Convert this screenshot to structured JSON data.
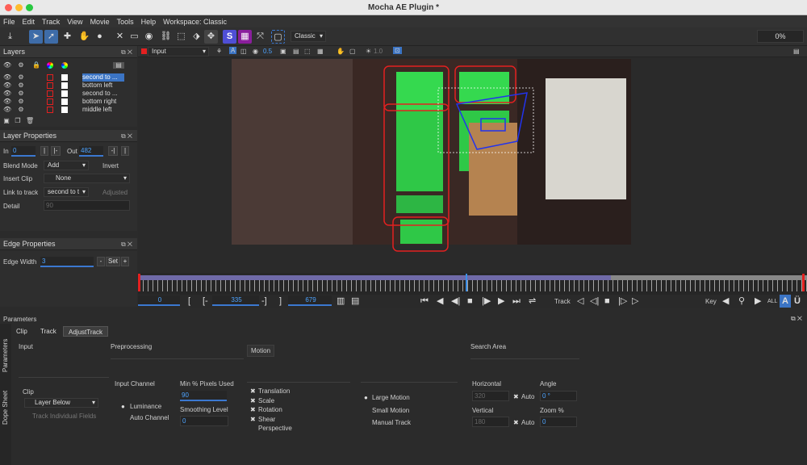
{
  "window": {
    "title": "Mocha AE Plugin *"
  },
  "menu": [
    "File",
    "Edit",
    "Track",
    "View",
    "Movie",
    "Tools",
    "Help",
    "Workspace: Classic"
  ],
  "toolbar": {
    "workspace_select": "Classic",
    "progress": "0%"
  },
  "viewer_bar": {
    "view_select": "Input",
    "value_a": "0.5",
    "value_b": "1.0"
  },
  "layers_panel": {
    "title": "Layers",
    "layers": [
      {
        "name": "second to ..."
      },
      {
        "name": "bottom left"
      },
      {
        "name": "second to ..."
      },
      {
        "name": "bottom right"
      },
      {
        "name": "middle left"
      }
    ]
  },
  "layer_properties": {
    "title": "Layer Properties",
    "in_label": "In",
    "in_value": "0",
    "out_label": "Out",
    "out_value": "482",
    "blend_mode_label": "Blend Mode",
    "blend_mode_value": "Add",
    "invert_label": "Invert",
    "insert_clip_label": "Insert Clip",
    "insert_clip_value": "None",
    "link_to_track_label": "Link to track",
    "link_to_track_value": "second to t",
    "adjusted_label": "Adjusted",
    "detail_label": "Detail",
    "detail_value": "90"
  },
  "edge_properties": {
    "title": "Edge Properties",
    "edge_width_label": "Edge Width",
    "edge_width_value": "3",
    "set_label": "Set"
  },
  "transport": {
    "current_frame": "0",
    "in_frame": "335",
    "out_frame": "679",
    "track_label": "Track",
    "key_label": "Key",
    "all_label": "ALL"
  },
  "params": {
    "title": "Parameters",
    "tabs": [
      "Clip",
      "Track",
      "AdjustTrack"
    ],
    "side_tabs": [
      "Parameters",
      "Dope Sheet"
    ],
    "input_header": "Input",
    "clip_label": "Clip",
    "clip_value": "Layer Below",
    "track_individual_fields": "Track Individual Fields",
    "preprocessing_header": "Preprocessing",
    "input_channel_label": "Input Channel",
    "luminance": "Luminance",
    "auto_channel": "Auto Channel",
    "min_pixels_label": "Min % Pixels Used",
    "min_pixels_value": "90",
    "smoothing_label": "Smoothing Level",
    "smoothing_value": "0",
    "motion_header": "Motion",
    "translation": "Translation",
    "scale": "Scale",
    "rotation": "Rotation",
    "shear": "Shear",
    "perspective": "Perspective",
    "large_motion": "Large Motion",
    "small_motion": "Small Motion",
    "manual_track": "Manual Track",
    "search_area_header": "Search Area",
    "horizontal_label": "Horizontal",
    "horizontal_value": "320",
    "vertical_label": "Vertical",
    "vertical_value": "180",
    "auto_label": "Auto",
    "angle_label": "Angle",
    "angle_value": "0 °",
    "zoom_label": "Zoom %",
    "zoom_value": "0"
  }
}
